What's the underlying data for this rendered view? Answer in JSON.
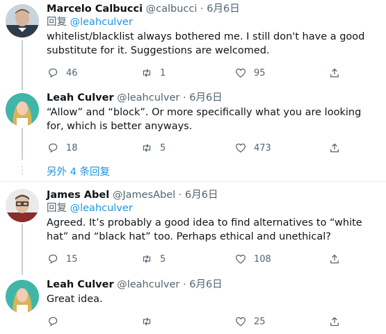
{
  "tweets": [
    {
      "name": "Marcelo Calbucci",
      "handle": "@calbucci",
      "dot": "·",
      "date": "6月6日",
      "reply_prefix": "回复",
      "reply_to": "@leahculver",
      "text": "whitelist/blacklist always bothered me. I still don't have a good substitute for it. Suggestions are welcomed.",
      "replies": "46",
      "retweets": "1",
      "likes": "95"
    },
    {
      "name": "Leah Culver",
      "handle": "@leahculver",
      "dot": "·",
      "date": "6月6日",
      "text": "“Allow” and “block”. Or more specifically what you are looking for, which is better anyways.",
      "replies": "18",
      "retweets": "5",
      "likes": "473"
    },
    {
      "name": "James Abel",
      "handle": "@JamesAbel",
      "dot": "·",
      "date": "6月6日",
      "reply_prefix": "回复",
      "reply_to": "@leahculver",
      "text": "Agreed. It’s probably a good idea to find alternatives to “white hat” and “black hat” too. Perhaps ethical and unethical?",
      "replies": "15",
      "retweets": "5",
      "likes": "108"
    },
    {
      "name": "Leah Culver",
      "handle": "@leahculver",
      "dot": "·",
      "date": "6月6日",
      "text": "Great idea.",
      "replies": "",
      "retweets": "",
      "likes": "25"
    }
  ],
  "more_replies_label": "另外 4 条回复",
  "icons": [
    "reply-icon",
    "retweet-icon",
    "like-icon",
    "share-icon"
  ],
  "colors": {
    "link": "#1b95e0",
    "muted": "#536471",
    "text": "#0f1419"
  }
}
